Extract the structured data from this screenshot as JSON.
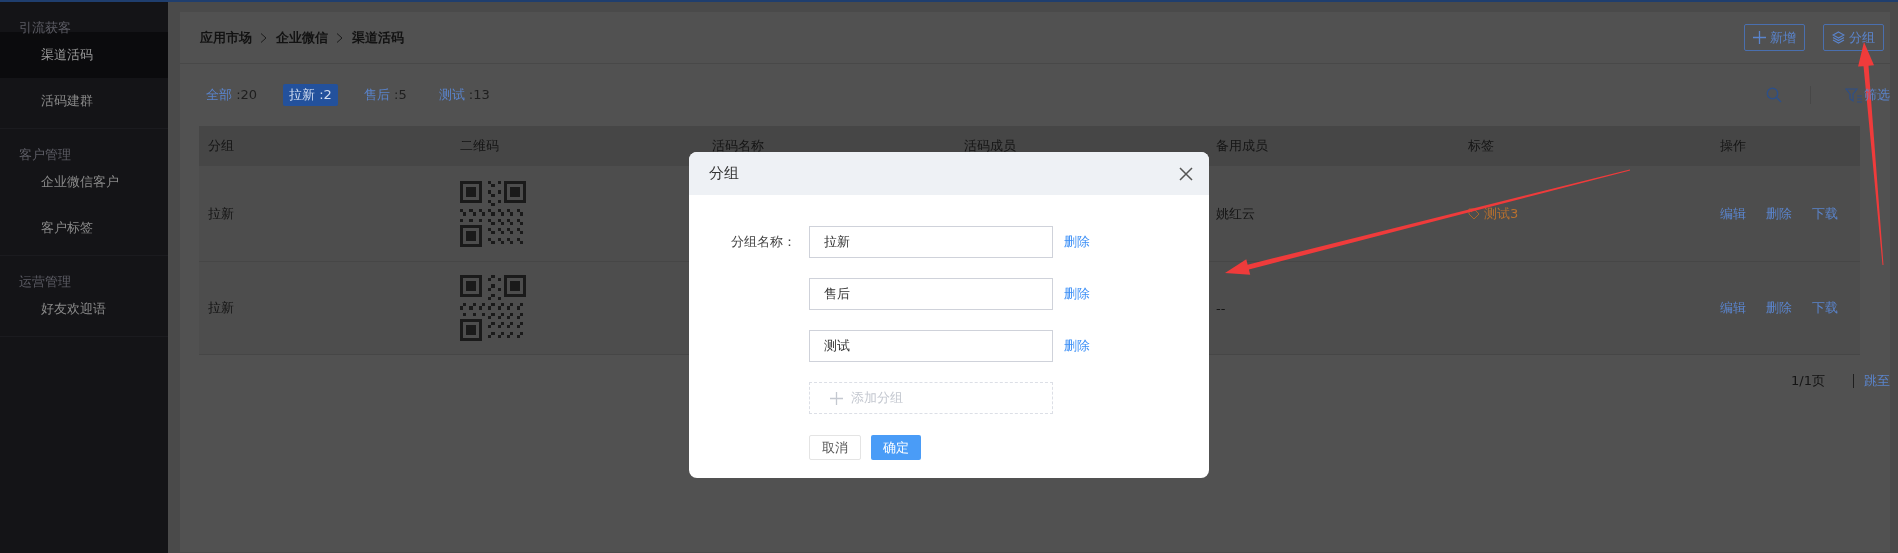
{
  "sidebar": {
    "sections": [
      {
        "title": "引流获客",
        "items": [
          {
            "label": "渠道活码",
            "selected": true
          },
          {
            "label": "活码建群",
            "selected": false
          }
        ]
      },
      {
        "title": "客户管理",
        "items": [
          {
            "label": "企业微信客户",
            "selected": false
          },
          {
            "label": "客户标签",
            "selected": false
          }
        ]
      },
      {
        "title": "运营管理",
        "items": [
          {
            "label": "好友欢迎语",
            "selected": false
          }
        ]
      }
    ]
  },
  "breadcrumb": [
    "应用市场",
    "企业微信",
    "渠道活码"
  ],
  "header_buttons": [
    {
      "label": "新增",
      "kind": "add"
    },
    {
      "label": "分组",
      "kind": "group"
    }
  ],
  "filter_tabs": [
    {
      "label": "全部",
      "count": ":20",
      "selected": false
    },
    {
      "label": "拉新",
      "count": ":2",
      "selected": true
    },
    {
      "label": "售后",
      "count": ":5",
      "selected": false
    },
    {
      "label": "测试",
      "count": ":13",
      "selected": false
    }
  ],
  "filter_label": "筛选",
  "table": {
    "columns": [
      "分组",
      "二维码",
      "活码名称",
      "活码成员",
      "备用成员",
      "标签",
      "操作"
    ],
    "rows": [
      {
        "group": "拉新",
        "backup_member": "姚红云",
        "tag": "测试3",
        "actions": [
          "编辑",
          "删除",
          "下载"
        ]
      },
      {
        "group": "拉新",
        "backup_member": "--",
        "actions": [
          "编辑",
          "删除",
          "下载"
        ]
      }
    ]
  },
  "pagination": {
    "page": "1/1页",
    "jump": "跳至"
  },
  "dialog": {
    "title": "分组",
    "field_label": "分组名称：",
    "groups": [
      {
        "value": "拉新",
        "delete": "删除"
      },
      {
        "value": "售后",
        "delete": "删除"
      },
      {
        "value": "测试",
        "delete": "删除"
      }
    ],
    "add_label": "添加分组",
    "cancel": "取消",
    "confirm": "确定"
  }
}
